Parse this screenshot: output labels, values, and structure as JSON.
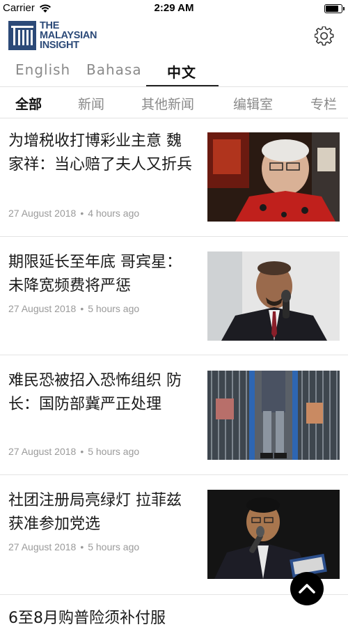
{
  "status_bar": {
    "carrier": "Carrier",
    "time": "2:29 AM",
    "battery_level": 0.85,
    "wifi_icon": "wifi-icon",
    "battery_icon": "battery-icon"
  },
  "header": {
    "logo_line1": "THE",
    "logo_line2": "MALAYSIAN",
    "logo_line3": "INSIGHT",
    "brand_color": "#2c4a78",
    "settings_icon": "gear-icon"
  },
  "language_tabs": [
    {
      "label": "English",
      "active": false
    },
    {
      "label": "Bahasa",
      "active": false
    },
    {
      "label": "中文",
      "active": true
    }
  ],
  "category_tabs": [
    {
      "label": "全部",
      "active": true
    },
    {
      "label": "新闻",
      "active": false
    },
    {
      "label": "其他新闻",
      "active": false
    },
    {
      "label": "编辑室",
      "active": false
    },
    {
      "label": "专栏",
      "active": false
    }
  ],
  "articles": [
    {
      "headline": "为增税收打博彩业主意 魏家祥：当心赔了夫人又折兵",
      "date": "27 August 2018",
      "separator": "•",
      "age": "4 hours ago"
    },
    {
      "headline": "期限延长至年底 哥宾星：未降宽频费将严惩",
      "date": "27 August 2018",
      "separator": "•",
      "age": "5 hours ago"
    },
    {
      "headline": "难民恐被招入恐怖组织 防长：国防部冀严正处理",
      "date": "27 August 2018",
      "separator": "•",
      "age": "5 hours ago"
    },
    {
      "headline": "社团注册局亮绿灯 拉菲兹获准参加党选",
      "date": "27 August 2018",
      "separator": "•",
      "age": "5 hours ago"
    },
    {
      "headline": "6至8月购普险须补付服",
      "date": "",
      "separator": "",
      "age": ""
    }
  ],
  "scroll_top_icon": "chevron-up-icon"
}
